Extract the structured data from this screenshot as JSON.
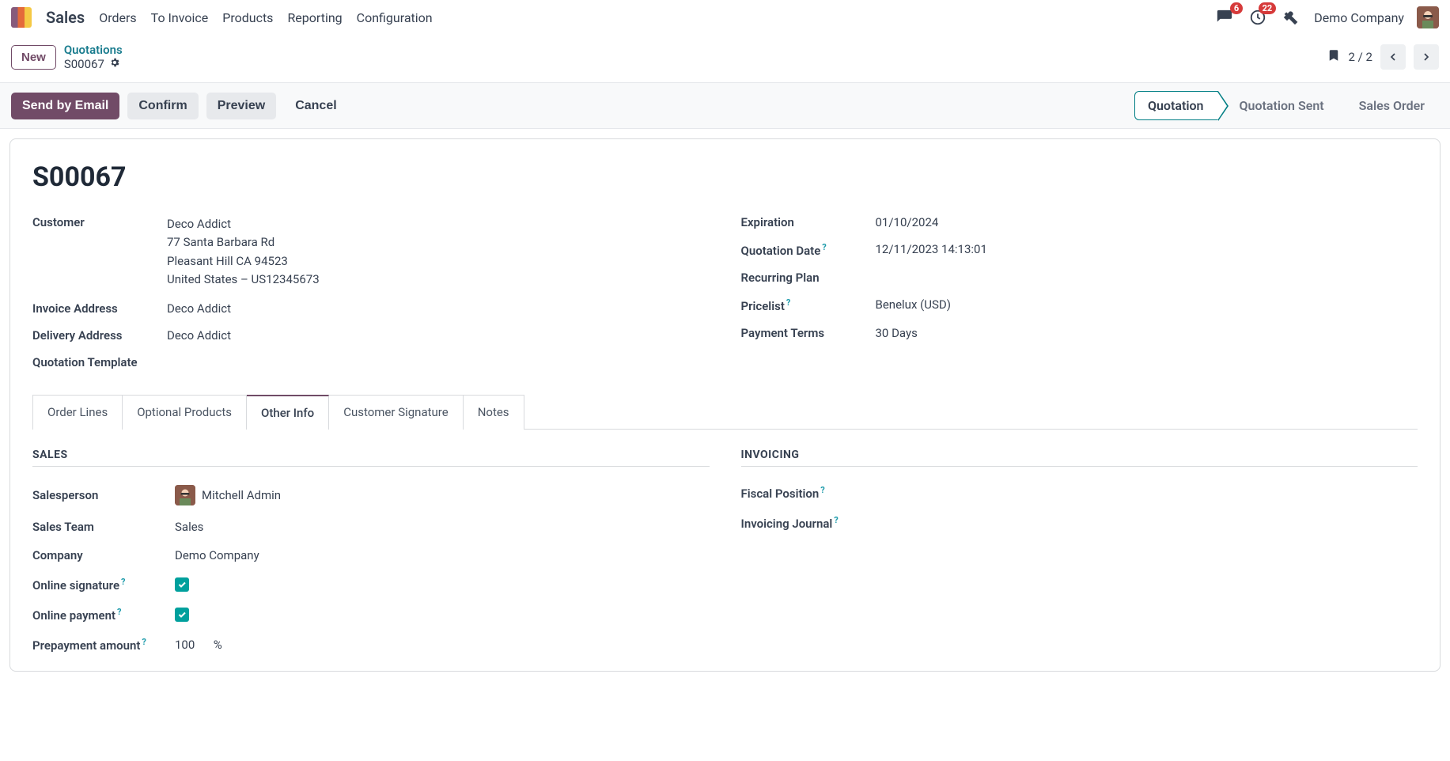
{
  "nav": {
    "app": "Sales",
    "items": [
      "Orders",
      "To Invoice",
      "Products",
      "Reporting",
      "Configuration"
    ],
    "msg_badge": "6",
    "clock_badge": "22",
    "company": "Demo Company"
  },
  "breadcrumb": {
    "new": "New",
    "parent": "Quotations",
    "current": "S00067"
  },
  "pager": {
    "text": "2 / 2"
  },
  "actions": {
    "send_email": "Send by Email",
    "confirm": "Confirm",
    "preview": "Preview",
    "cancel": "Cancel"
  },
  "status": {
    "quotation": "Quotation",
    "sent": "Quotation Sent",
    "order": "Sales Order"
  },
  "record": {
    "title": "S00067",
    "left": {
      "customer_label": "Customer",
      "customer_name": "Deco Addict",
      "customer_addr1": "77 Santa Barbara Rd",
      "customer_addr2": "Pleasant Hill CA 94523",
      "customer_addr3": "United States – US12345673",
      "invoice_addr_label": "Invoice Address",
      "invoice_addr": "Deco Addict",
      "delivery_addr_label": "Delivery Address",
      "delivery_addr": "Deco Addict",
      "qtemplate_label": "Quotation Template"
    },
    "right": {
      "expiration_label": "Expiration",
      "expiration": "01/10/2024",
      "qdate_label": "Quotation Date",
      "qdate": "12/11/2023 14:13:01",
      "recurring_label": "Recurring Plan",
      "pricelist_label": "Pricelist",
      "pricelist": "Benelux (USD)",
      "terms_label": "Payment Terms",
      "terms": "30 Days"
    }
  },
  "tabs": {
    "order_lines": "Order Lines",
    "optional": "Optional Products",
    "other": "Other Info",
    "signature": "Customer Signature",
    "notes": "Notes"
  },
  "other_info": {
    "sales_title": "SALES",
    "invoicing_title": "INVOICING",
    "salesperson_label": "Salesperson",
    "salesperson": "Mitchell Admin",
    "team_label": "Sales Team",
    "team": "Sales",
    "company_label": "Company",
    "company": "Demo Company",
    "sig_label": "Online signature",
    "pay_label": "Online payment",
    "prepay_label": "Prepayment amount",
    "prepay_value": "100",
    "prepay_unit": "%",
    "fiscal_label": "Fiscal Position",
    "journal_label": "Invoicing Journal"
  }
}
